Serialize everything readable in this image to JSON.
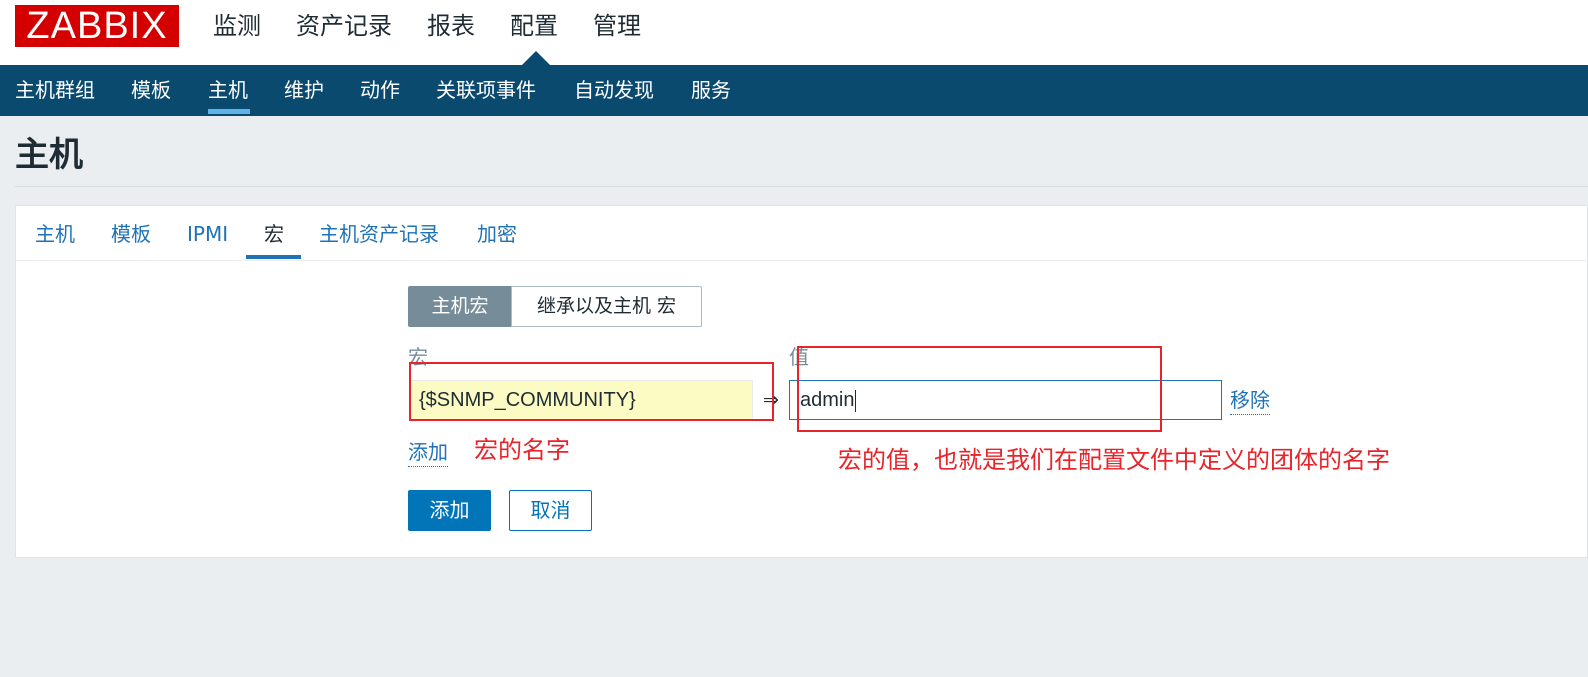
{
  "header": {
    "logo": "ZABBIX",
    "menu": [
      {
        "label": "监测"
      },
      {
        "label": "资产记录"
      },
      {
        "label": "报表"
      },
      {
        "label": "配置",
        "active": true
      },
      {
        "label": "管理"
      }
    ]
  },
  "subnav": {
    "items": [
      {
        "label": "主机群组"
      },
      {
        "label": "模板"
      },
      {
        "label": "主机",
        "active": true
      },
      {
        "label": "维护"
      },
      {
        "label": "动作"
      },
      {
        "label": "关联项事件"
      },
      {
        "label": "自动发现"
      },
      {
        "label": "服务"
      }
    ]
  },
  "page": {
    "title": "主机"
  },
  "tabs": [
    {
      "label": "主机"
    },
    {
      "label": "模板"
    },
    {
      "label": "IPMI"
    },
    {
      "label": "宏",
      "active": true
    },
    {
      "label": "主机资产记录"
    },
    {
      "label": "加密"
    }
  ],
  "macros": {
    "switch": {
      "host_macros": "主机宏",
      "inherited": "继承以及主机 宏"
    },
    "col_macro": "宏",
    "col_value": "值",
    "row": {
      "macro": "{$SNMP_COMMUNITY}",
      "arrow": "⇒",
      "value": "admin",
      "remove": "移除"
    },
    "add_link": "添加"
  },
  "buttons": {
    "add": "添加",
    "cancel": "取消"
  },
  "annotations": {
    "macro_name": "宏的名字",
    "macro_value": "宏的值，也就是我们在配置文件中定义的团体的名字",
    "color": "#e6242a"
  }
}
